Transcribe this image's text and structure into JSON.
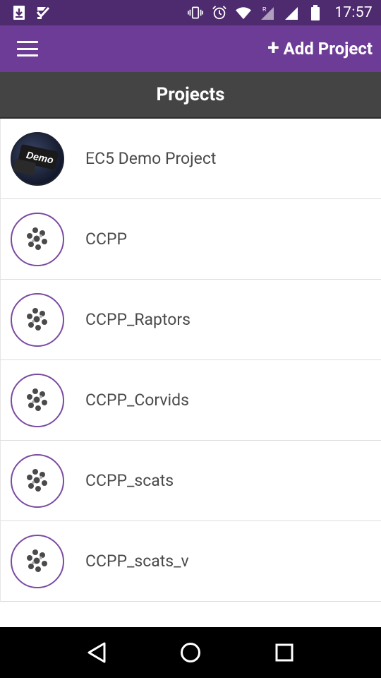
{
  "status_bar": {
    "time": "17:57",
    "icons": [
      "download-icon",
      "task-check-icon",
      "vibrate-icon",
      "alarm-icon",
      "wifi-icon",
      "signal-roaming-icon",
      "signal-icon",
      "battery-icon"
    ]
  },
  "app_bar": {
    "menu_icon": "hamburger-menu-icon",
    "add_project_label": "Add Project",
    "add_icon": "+"
  },
  "header": {
    "title": "Projects"
  },
  "projects": [
    {
      "name": "EC5 Demo Project",
      "logo": "Demo"
    },
    {
      "name": "CCPP",
      "logo": "default-project-logo"
    },
    {
      "name": "CCPP_Raptors",
      "logo": "default-project-logo"
    },
    {
      "name": "CCPP_Corvids",
      "logo": "default-project-logo"
    },
    {
      "name": "CCPP_scats",
      "logo": "default-project-logo"
    },
    {
      "name": "CCPP_scats_v",
      "logo": "default-project-logo"
    }
  ],
  "nav_bar": {
    "buttons": [
      "back-icon",
      "home-icon",
      "recents-icon"
    ]
  },
  "colors": {
    "status_bar": "#4e2a6e",
    "app_bar": "#6d3c96",
    "header": "#444444",
    "logo_border": "#7a4aa0",
    "nav_bar": "#000000"
  }
}
